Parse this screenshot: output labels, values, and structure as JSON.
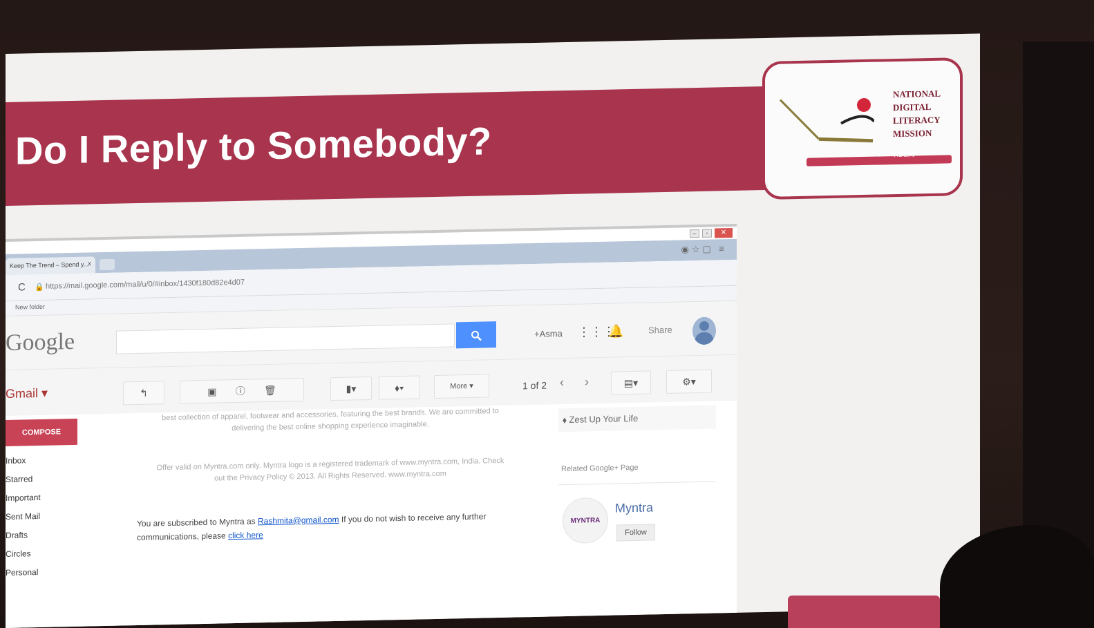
{
  "slide": {
    "title": "Do I Reply to Somebody?",
    "logo_lines": [
      "NATIONAL",
      "DIGITAL",
      "LITERACY",
      "MISSION"
    ],
    "logo_badge": "NDLM"
  },
  "browser": {
    "tab_title": "Keep The Trend – Spend y...",
    "tab_close": "x",
    "url": "https://mail.google.com/mail/u/0/#inbox/1430f180d82e4d07",
    "bookmark": "New folder"
  },
  "google": {
    "logo": "Google",
    "search_button_icon": "search-icon",
    "plus_name": "+Asma",
    "share_label": "Share"
  },
  "toolbar": {
    "gmail_label": "Gmail ▾",
    "reply_icon": "↰",
    "more_label": "More ▾",
    "pager": "1 of 2",
    "prev": "‹",
    "next": "›"
  },
  "sidebar": {
    "compose": "COMPOSE",
    "items": [
      "Inbox",
      "Starred",
      "Important",
      "Sent Mail",
      "Drafts",
      "Circles",
      "Personal"
    ]
  },
  "message": {
    "faded_1": "best collection of apparel, footwear and accessories, featuring the best brands. We are committed to delivering the best online shopping experience imaginable.",
    "faded_2": "Offer valid on Myntra.com only. Myntra logo is a registered trademark of www.myntra.com, India. Check out the Privacy Policy © 2013. All Rights Reserved. www.myntra.com",
    "subscribed_prefix": "You are subscribed to Myntra as",
    "subscribed_email": "Rashmita@gmail.com",
    "subscribed_suffix": "If you do not wish to receive any further communications, please",
    "click_here": "click here"
  },
  "rightpane": {
    "zest": "Zest Up Your Life",
    "related": "Related Google+ Page",
    "brand_logo_text": "MYNTRA",
    "brand_name": "Myntra",
    "follow": "Follow"
  },
  "colors": {
    "banner": "#a8344d",
    "compose": "#c94356",
    "search_button": "#4d90fe"
  }
}
